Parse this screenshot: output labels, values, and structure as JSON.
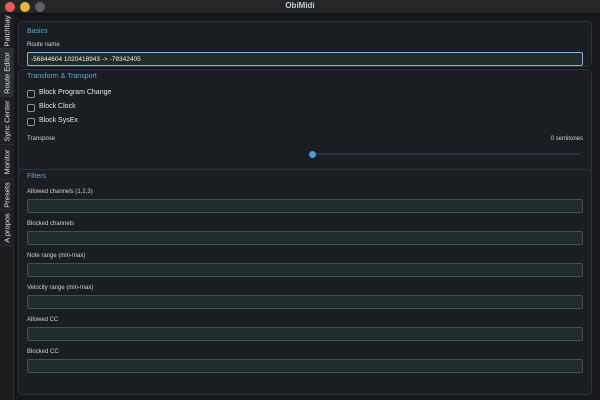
{
  "window": {
    "title": "ObiMidi"
  },
  "tabs": [
    {
      "label": "Patchbay"
    },
    {
      "label": "Route Editor"
    },
    {
      "label": "Sync Center"
    },
    {
      "label": "Monitor"
    },
    {
      "label": "Presets"
    },
    {
      "label": "A propos"
    }
  ],
  "basics": {
    "title": "Basics",
    "route_name_label": "Route name",
    "route_name_value": "-56844604 1020418943 -> -79342405"
  },
  "transform": {
    "title": "Transform & Transport",
    "checkboxes": [
      {
        "label": "Block Program Change",
        "checked": false
      },
      {
        "label": "Block Clock",
        "checked": false
      },
      {
        "label": "Block SysEx",
        "checked": false
      }
    ],
    "transpose_label": "Transpose",
    "transpose_value": "0 semitones",
    "transpose_slider_fraction": 0.0
  },
  "filters": {
    "title": "Filters",
    "fields": [
      {
        "label": "Allowed channels (1,2,3)",
        "value": ""
      },
      {
        "label": "Blocked channels",
        "value": ""
      },
      {
        "label": "Note range (min-max)",
        "value": ""
      },
      {
        "label": "Velocity range (min-max)",
        "value": ""
      },
      {
        "label": "Allowed CC",
        "value": ""
      },
      {
        "label": "Blocked CC",
        "value": ""
      }
    ]
  },
  "colors": {
    "accent": "#59a9d6",
    "slider_thumb": "#3fa4cf",
    "background": "#15171a"
  }
}
